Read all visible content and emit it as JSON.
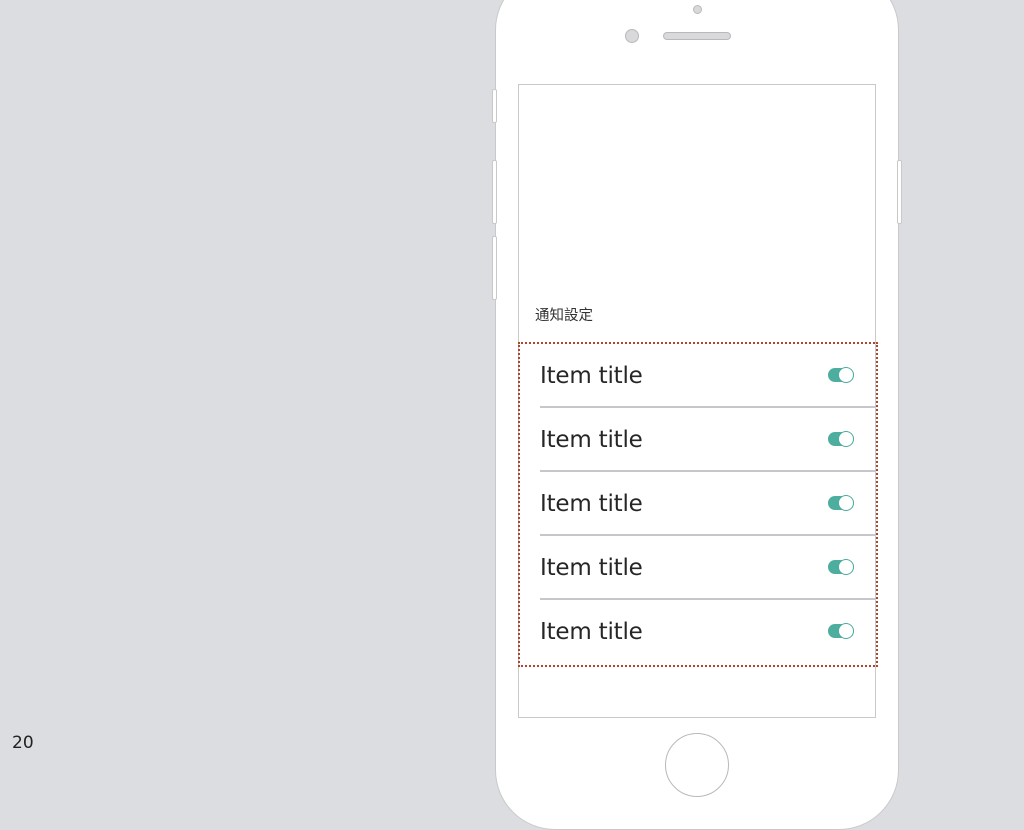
{
  "slide": {
    "page_number": "20"
  },
  "screen": {
    "section_label": "通知設定",
    "items": [
      {
        "title": "Item title",
        "toggle_on": true
      },
      {
        "title": "Item title",
        "toggle_on": true
      },
      {
        "title": "Item title",
        "toggle_on": true
      },
      {
        "title": "Item title",
        "toggle_on": true
      },
      {
        "title": "Item title",
        "toggle_on": true
      }
    ]
  },
  "colors": {
    "toggle_on": "#4dae9f",
    "highlight_border": "#b0442f",
    "background": "#dcdde0"
  }
}
